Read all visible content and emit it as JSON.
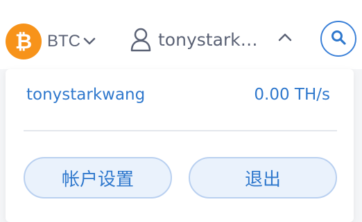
{
  "header": {
    "coin": {
      "symbol": "₿",
      "name": "BTC",
      "logo_color": "#f7931a"
    },
    "user": {
      "display_name": "tonystark…"
    },
    "icons": {
      "coin_dropdown": "chevron-down-icon",
      "user": "user-icon",
      "user_toggle": "chevron-up-icon",
      "search": "search-icon"
    }
  },
  "panel": {
    "account_name": "tonystarkwang",
    "hashrate": "0.00 TH/s",
    "settings_label": "帐户设置",
    "logout_label": "退出"
  },
  "colors": {
    "accent": "#2f78cd",
    "button_bg": "#eaf2fc",
    "button_border": "#b9d0f0"
  }
}
